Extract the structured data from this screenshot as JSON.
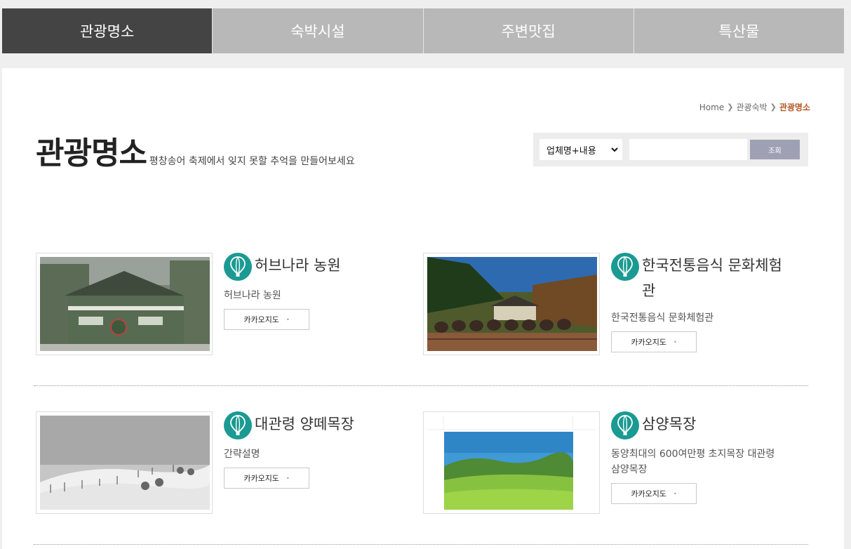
{
  "tabs": [
    {
      "label": "관광명소",
      "active": true
    },
    {
      "label": "숙박시설",
      "active": false
    },
    {
      "label": "주변맛집",
      "active": false
    },
    {
      "label": "특산물",
      "active": false
    }
  ],
  "breadcrumb": {
    "home": "Home",
    "section": "관광숙박",
    "current": "관광명소"
  },
  "page": {
    "title": "관광명소",
    "subtitle": "평창송어 축제에서 잊지 못할 추억을 만들어보세요"
  },
  "search": {
    "select_value": "업체명+내용",
    "input_value": "",
    "button_label": "조회"
  },
  "colors": {
    "active_tab": "#444444",
    "tab": "#b8b8b8",
    "accent": "#1a9a92",
    "breadcrumb_current": "#b4541f",
    "search_button": "#9ea1b4"
  },
  "items": [
    {
      "name": "허브나라 농원",
      "desc": "허브나라 농원",
      "map_label": "카카오지도",
      "icon": "balloon-icon"
    },
    {
      "name": "한국전통음식 문화체험관",
      "desc": "한국전통음식 문화체험관",
      "map_label": "카카오지도",
      "icon": "balloon-icon"
    },
    {
      "name": "대관령 양떼목장",
      "desc": "간략설명",
      "map_label": "카카오지도",
      "icon": "balloon-icon"
    },
    {
      "name": "삼양목장",
      "desc": "동양최대의 600여만평 초지목장 대관령 삼양목장",
      "map_label": "카카오지도",
      "icon": "balloon-icon"
    }
  ]
}
